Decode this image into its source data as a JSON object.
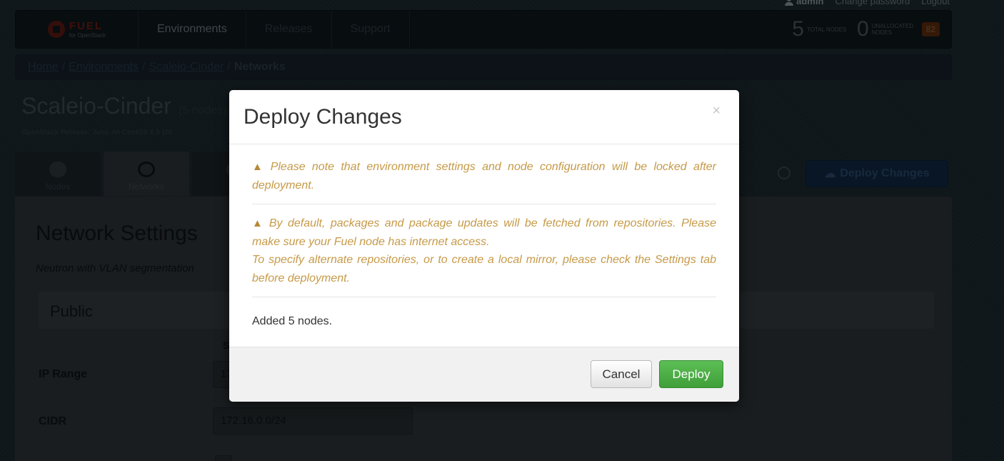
{
  "user": {
    "name": "admin",
    "change_password": "Change password",
    "logout": "Logout"
  },
  "navbar": {
    "logo_title": "FUEL",
    "logo_sub": "for OpenStack",
    "items": [
      "Environments",
      "Releases",
      "Support"
    ],
    "total_nodes": "5",
    "total_nodes_label": "TOTAL NODES",
    "unallocated_nodes": "0",
    "unallocated_label": "UNALLOCATED NODES",
    "notifications": "82"
  },
  "breadcrumb": {
    "home": "Home",
    "environments": "Environments",
    "env": "Scaleio-Cinder",
    "current": "Networks"
  },
  "environment": {
    "name": "Scaleio-Cinder",
    "node_count": "(5 nodes)",
    "release": "OpenStack Release: Juno on CentOS 6.5 (20"
  },
  "tabs": [
    "Nodes",
    "Networks",
    "Se"
  ],
  "deploy_button": "Deploy Changes",
  "network": {
    "title": "Network Settings",
    "subtitle": "Neutron with VLAN segmentation",
    "section": "Public",
    "col_head": "S",
    "ip_range_label": "IP Range",
    "ip_range_value": "17",
    "cidr_label": "CIDR",
    "cidr_value": "172.16.0.0/24"
  },
  "modal": {
    "title": "Deploy Changes",
    "close": "×",
    "warning_icon": "warning-triangle",
    "warning1": "Please note that environment settings and node configuration will be locked after deployment.",
    "warning2_line1": "By default, packages and package updates will be fetched from repositories. Please make sure your Fuel node has internet access.",
    "warning2_line2": "To specify alternate repositories, or to create a local mirror, please check the Settings tab before deployment.",
    "added": "Added 5 nodes.",
    "cancel": "Cancel",
    "deploy": "Deploy"
  },
  "colors": {
    "warning_text": "#c69a48",
    "deploy_green": "#4cae45",
    "overlay": "rgba(0,0,0,0.42)"
  }
}
